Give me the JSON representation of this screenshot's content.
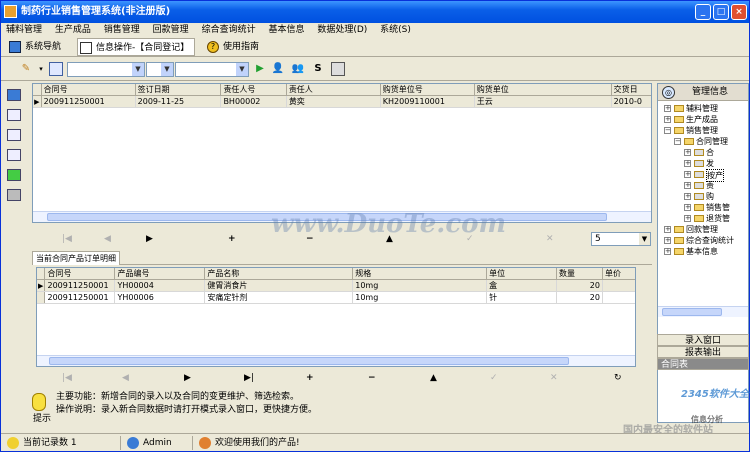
{
  "window": {
    "title": "制药行业销售管理系统(非注册版)",
    "btn_min": "_",
    "btn_max": "□",
    "btn_close": "×"
  },
  "menu": [
    "辅料管理",
    "生产成品",
    "销售管理",
    "回款管理",
    "综合查询统计",
    "基本信息",
    "数据处理(D)",
    "系统(S)"
  ],
  "tabs": {
    "nav": "系统导航",
    "info": "信息操作-【合同登记】",
    "help": "使用指南"
  },
  "toolbar": {
    "combo1": "",
    "combo2": "",
    "combo3": ""
  },
  "grid1": {
    "columns": [
      "合同号",
      "签订日期",
      "责任人号",
      "责任人",
      "购货单位号",
      "购货单位",
      "交货日"
    ],
    "rows": [
      [
        "200911250001",
        "2009-11-25",
        "BH00002",
        "黄奕",
        "KH2009110001",
        "王云",
        "2010-0"
      ]
    ]
  },
  "nav": {
    "first": "|◀",
    "prev": "◀",
    "next": "▶",
    "last": "▶|",
    "add": "+",
    "del": "−",
    "up": "▲",
    "check": "✓",
    "cancel": "✕",
    "refresh": "↻",
    "page_size": "5"
  },
  "subtab": "当前合同产品订单明细",
  "grid2": {
    "columns": [
      "合同号",
      "产品编号",
      "产品名称",
      "规格",
      "单位",
      "数量",
      "单价"
    ],
    "rows": [
      [
        "200911250001",
        "YH00004",
        "健胃消食片",
        "10mg",
        "盒",
        "20",
        ""
      ],
      [
        "200911250001",
        "YH00006",
        "安痛定针剂",
        "10mg",
        "针",
        "20",
        ""
      ]
    ]
  },
  "tips": {
    "label": "提示",
    "line1": "主要功能：新增合同的录入以及合同的变更维护、筛选检索。",
    "line2": "操作说明：录入新合同数据时请打开模式录入窗口，更快捷方便。"
  },
  "rpanel": {
    "title": "管理信息",
    "tree": [
      "辅料管理",
      "生产成品",
      "销售管理",
      "合同管理",
      "合",
      "发",
      "按产",
      "责",
      "购",
      "销售管",
      "退货管",
      "回款管理",
      "综合查询统计",
      "基本信息"
    ]
  },
  "rbtns": {
    "entry": "录入窗口",
    "export": "报表输出",
    "contract_table": "合同表"
  },
  "status": {
    "records": "当前记录数 1",
    "user": "Admin",
    "welcome": "欢迎使用我们的产品!"
  },
  "watermark": {
    "site": "www.DuoTe.com",
    "logo": "2345软件大全",
    "logo_sub": "国内最安全的软件站",
    "analysis": "信息分析"
  }
}
